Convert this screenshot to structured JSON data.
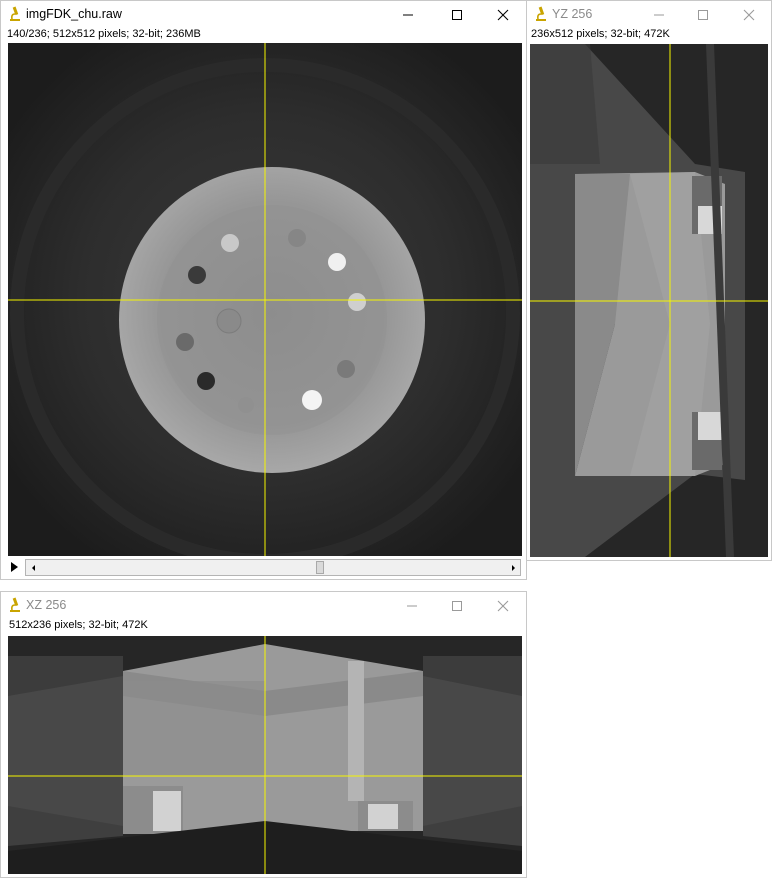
{
  "windows": {
    "main": {
      "title": "imgFDK_chu.raw",
      "info": "140/236; 512x512 pixels; 32-bit; 236MB",
      "slice_position": 0.6
    },
    "yz": {
      "title": "YZ 256",
      "info": "236x512 pixels; 32-bit; 472K"
    },
    "xz": {
      "title": "XZ 256",
      "info": "512x236 pixels; 32-bit; 472K"
    }
  },
  "colors": {
    "crosshair": "#f5f500",
    "background": "#242424",
    "phantom": "#9a9a9a",
    "active_title": "#000000",
    "inactive_title": "#8a8a8a"
  },
  "icons": {
    "app": "microscope-icon",
    "minimize": "minimize-icon",
    "maximize": "maximize-icon",
    "close": "close-icon"
  }
}
